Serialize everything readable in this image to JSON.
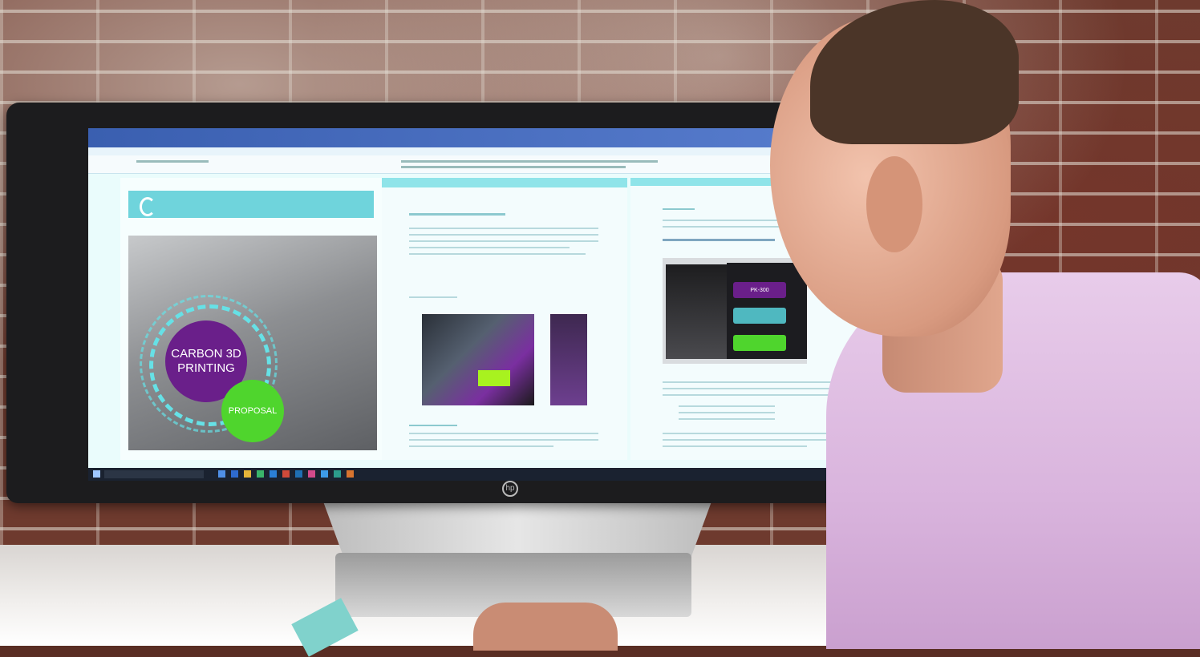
{
  "scene": {
    "hero_title_line1": "CARBON 3D",
    "hero_title_line2": "PRINTING",
    "hero_subtitle": "PROPOSAL",
    "panel_buttons": [
      "PK-300"
    ],
    "colors": {
      "accent_teal": "#6fd4dc",
      "purple": "#6a1f8a",
      "green": "#4fd52d"
    },
    "icons": [
      "windows-start-icon",
      "hp-logo-icon"
    ]
  }
}
